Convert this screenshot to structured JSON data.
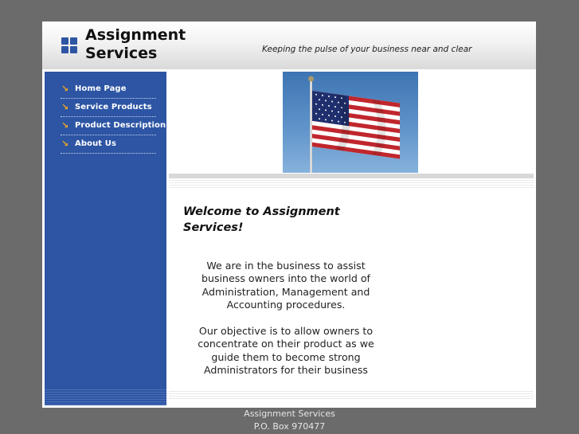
{
  "header": {
    "title_line1": "Assignment",
    "title_line2": "Services",
    "tagline": "Keeping the pulse of your business near and clear"
  },
  "nav": {
    "items": [
      {
        "label": "Home Page"
      },
      {
        "label": "Service Products"
      },
      {
        "label": "Product Description"
      },
      {
        "label": "About Us"
      }
    ],
    "arrow_icon": "arrow-icon",
    "arrow_color": "#f2a81d"
  },
  "hero": {
    "image": "american-flag"
  },
  "main": {
    "welcome": "Welcome to Assignment Services!",
    "paragraph1": "We are in the business to assist business owners into the world of Administration, Management and Accounting procedures.",
    "paragraph2": "Our objective is to allow owners to concentrate on their product as we guide them to become strong Administrators for their business"
  },
  "footer": {
    "line1": "Assignment Services",
    "line2": "P.O. Box 970477"
  },
  "colors": {
    "background": "#6b6b6b",
    "sidebar": "#2d55a4",
    "accent": "#f2a81d"
  }
}
